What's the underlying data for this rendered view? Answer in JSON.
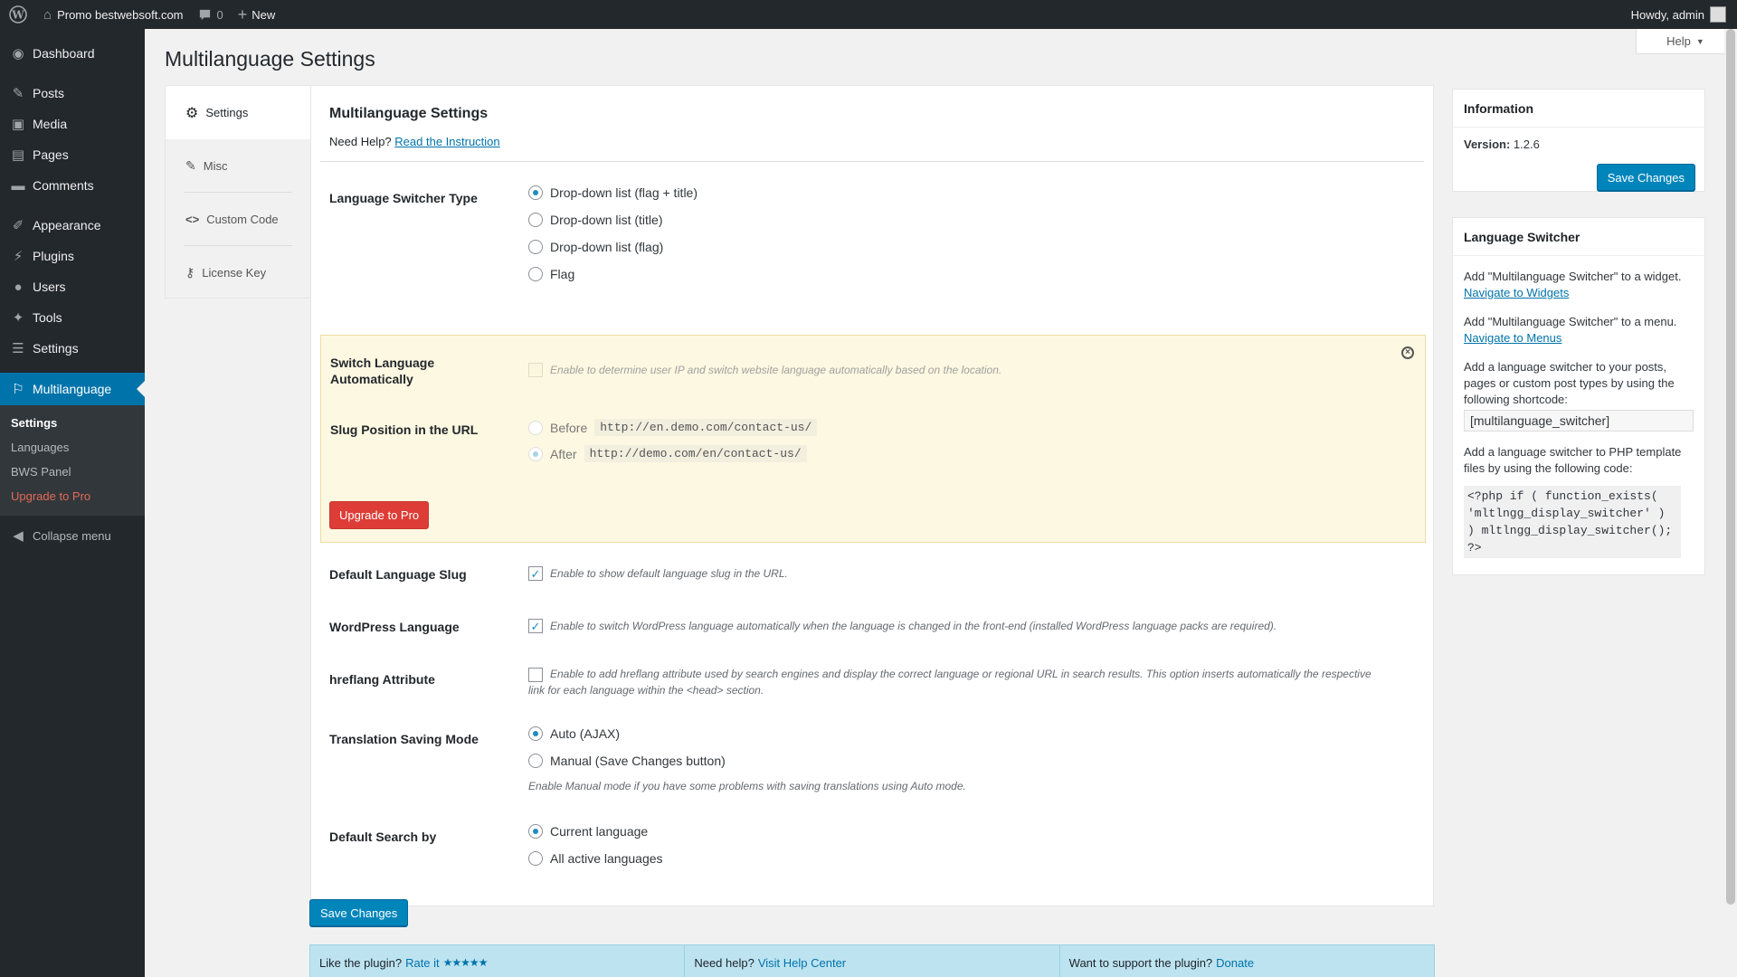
{
  "adminbar": {
    "site_name": "Promo bestwebsoft.com",
    "comments_count": "0",
    "new_label": "New",
    "howdy": "Howdy, admin"
  },
  "sidebar": {
    "items": [
      {
        "label": "Dashboard",
        "icon": "dashboard-icon"
      },
      {
        "label": "Posts",
        "icon": "pin-icon"
      },
      {
        "label": "Media",
        "icon": "media-icon"
      },
      {
        "label": "Pages",
        "icon": "pages-icon"
      },
      {
        "label": "Comments",
        "icon": "comment-icon"
      },
      {
        "label": "Appearance",
        "icon": "brush-icon"
      },
      {
        "label": "Plugins",
        "icon": "plug-icon"
      },
      {
        "label": "Users",
        "icon": "user-icon"
      },
      {
        "label": "Tools",
        "icon": "wrench-icon"
      },
      {
        "label": "Settings",
        "icon": "settings-icon"
      }
    ],
    "current": "Multilanguage",
    "submenu": [
      "Settings",
      "Languages",
      "BWS Panel",
      "Upgrade to Pro"
    ],
    "collapse": "Collapse menu"
  },
  "help_label": "Help",
  "page_title": "Multilanguage Settings",
  "tabs": [
    "Settings",
    "Misc",
    "Custom Code",
    "License Key"
  ],
  "panel": {
    "heading": "Multilanguage Settings",
    "need_help": "Need Help?",
    "instruction_link": "Read the Instruction",
    "switcher_type": {
      "label": "Language Switcher Type",
      "options": [
        "Drop-down list (flag + title)",
        "Drop-down list (title)",
        "Drop-down list (flag)",
        "Flag"
      ],
      "selected": 0
    },
    "pro": {
      "switch_auto_label": "Switch Language Automatically",
      "switch_auto_desc": "Enable to determine user IP and switch website language automatically based on the location.",
      "slug_label": "Slug Position in the URL",
      "before_label": "Before",
      "before_code": "http://en.demo.com/contact-us/",
      "after_label": "After",
      "after_code": "http://demo.com/en/contact-us/",
      "upgrade_button": "Upgrade to Pro"
    },
    "default_slug": {
      "label": "Default Language Slug",
      "desc": "Enable to show default language slug in the URL.",
      "checked": true
    },
    "wp_language": {
      "label": "WordPress Language",
      "desc": "Enable to switch WordPress language automatically when the language is changed in the front-end (installed WordPress language packs are required).",
      "checked": true
    },
    "hreflang": {
      "label": "hreflang Attribute",
      "desc": "Enable to add hreflang attribute used by search engines and display the correct language or regional URL in search results. This option inserts automatically the respective link for each language within the <head> section.",
      "checked": false
    },
    "saving_mode": {
      "label": "Translation Saving Mode",
      "options": [
        "Auto (AJAX)",
        "Manual (Save Changes button)"
      ],
      "selected": 0,
      "desc": "Enable Manual mode if you have some problems with saving translations using Auto mode."
    },
    "search_by": {
      "label": "Default Search by",
      "options": [
        "Current language",
        "All active languages"
      ],
      "selected": 0
    }
  },
  "save_button": "Save Changes",
  "footer": {
    "like": "Like the plugin?",
    "rate": "Rate it",
    "stars": "★★★★★",
    "need_help": "Need help?",
    "help_center": "Visit Help Center",
    "support": "Want to support the plugin?",
    "donate": "Donate"
  },
  "info_box": {
    "title": "Information",
    "version_label": "Version:",
    "version": "1.2.6",
    "save_button": "Save Changes"
  },
  "switcher_box": {
    "title": "Language Switcher",
    "widget_text": "Add \"Multilanguage Switcher\" to a widget.",
    "widget_link": "Navigate to Widgets",
    "menu_text": "Add \"Multilanguage Switcher\" to a menu.",
    "menu_link": "Navigate to Menus",
    "shortcode_text": "Add a language switcher to your posts, pages or custom post types by using the following shortcode:",
    "shortcode": "[multilanguage_switcher]",
    "php_text": "Add a language switcher to PHP template files by using the following code:",
    "php_code": "<?php if ( function_exists( 'mltlngg_display_switcher' ) ) mltlngg_display_switcher(); ?>"
  }
}
